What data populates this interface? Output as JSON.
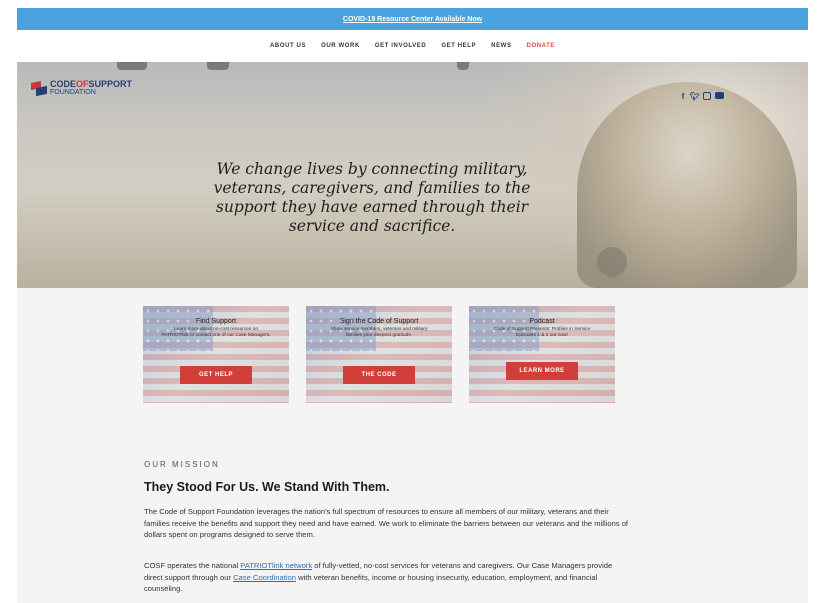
{
  "announcement": {
    "text": "COVID-19 Resource Center Available Now"
  },
  "nav": {
    "items": [
      "ABOUT US",
      "OUR WORK",
      "GET INVOLVED",
      "GET HELP",
      "NEWS",
      "DONATE"
    ]
  },
  "logo": {
    "line1_a": "CODE",
    "line1_sep": "OF",
    "line1_b": "SUPPORT",
    "line2": "FOUNDATION"
  },
  "social": {
    "icons": [
      "facebook-icon",
      "twitter-icon",
      "instagram-icon",
      "youtube-icon"
    ],
    "color": "#1f3f7a"
  },
  "hero": {
    "tagline": "We change lives by connecting military, veterans, caregivers, and families to the support they have earned through their service and sacrifice."
  },
  "cards": [
    {
      "title": "Find Support",
      "desc": "Learn more about no-cost resources on PATRIOTlink or contact one of our Case Managers.",
      "button": "GET HELP"
    },
    {
      "title": "Sign the Code of Support",
      "desc": "Show service members, veterans and military families your deepest gratitude.",
      "button": "THE CODE"
    },
    {
      "title": "Podcast",
      "desc": "Code of Support Presents: Profiles in Service Episodes 1 & 2 out now!",
      "button": "LEARN MORE"
    }
  ],
  "mission": {
    "label": "OUR MISSION",
    "heading": "They Stood For Us. We Stand With Them.",
    "para1": "The Code of Support Foundation leverages the nation's full spectrum of resources to ensure all members of our military, veterans and their families receive the benefits and support they need and have earned. We work to eliminate the barriers between our veterans and the millions of dollars spent on programs designed to serve them.",
    "para2_a": "COSF operates the national ",
    "para2_link1": "PATRIOTlink network",
    "para2_b": " of fully-vetted, no-cost services for veterans and caregivers. Our Case Managers provide direct support through our ",
    "para2_link2": "Case Coordination",
    "para2_c": " with veteran benefits, income or housing insecurity, education, employment, and financial counseling."
  },
  "colors": {
    "announcement_bg": "#4aa3de",
    "accent_red": "#d23f3b",
    "navy": "#27406f"
  }
}
